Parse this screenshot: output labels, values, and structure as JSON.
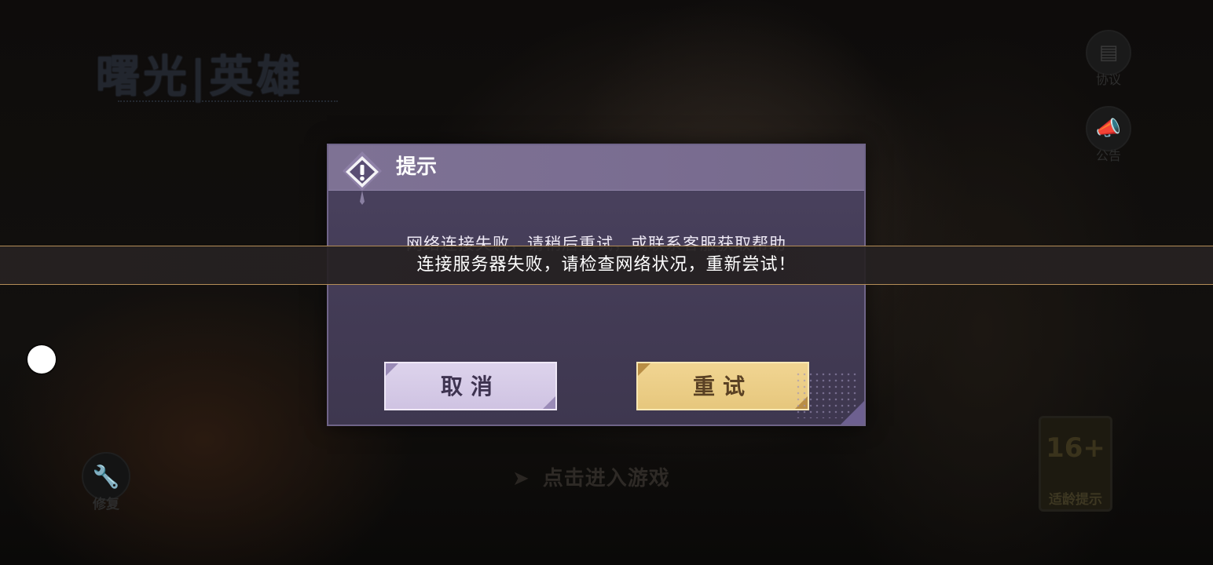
{
  "background": {
    "logo_text": "曙光|英雄",
    "side_buttons": [
      {
        "label": "协议",
        "icon": "agreement-icon"
      },
      {
        "label": "公告",
        "icon": "announcement-icon"
      }
    ],
    "repair": {
      "label": "修复",
      "icon": "wrench-icon"
    },
    "enter_game": "点击进入游戏",
    "age_rating": {
      "number": "16+",
      "label": "适龄提示"
    }
  },
  "dialog": {
    "title": "提示",
    "message": "网络连接失败，请稍后重试，或联系客服获取帮助",
    "cancel_label": "取消",
    "retry_label": "重试",
    "icon": "warning-icon"
  },
  "toast": {
    "text": "连接服务器失败，请检查网络状况，重新尝试！"
  },
  "colors": {
    "dialog_bg": "#453d58",
    "dialog_header": "#7a6d91",
    "cancel_button": "#d9cfe9",
    "retry_button": "#efd28d",
    "toast_border": "#b48d57"
  }
}
